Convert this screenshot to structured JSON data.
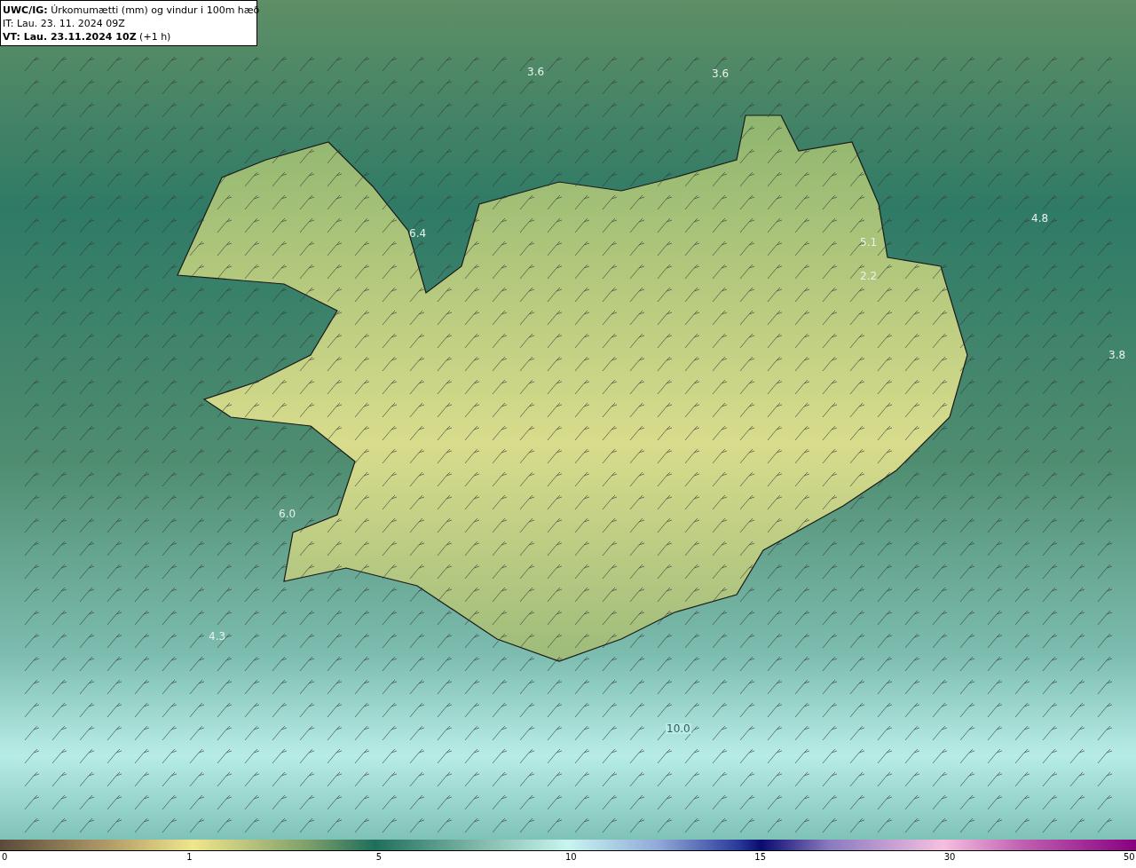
{
  "legend_box": {
    "title": "**UWC/IG:** Úrkomumætti (mm) og vindur i 100m hæð",
    "issue_time": "IT: Lau. 23. 11. 2024 09Z",
    "valid_time": "**VT: Lau. 23.11.2024 10Z** (+1 h)"
  },
  "map_labels": [
    "3.6",
    "3.6",
    "6.4",
    "4.8",
    "5.1",
    "2.2",
    "3.8",
    "6.0",
    "4.3",
    "10.0"
  ],
  "colorbar": {
    "ticks": [
      "0",
      "1",
      "5",
      "10",
      "15",
      "30",
      "50"
    ]
  }
}
